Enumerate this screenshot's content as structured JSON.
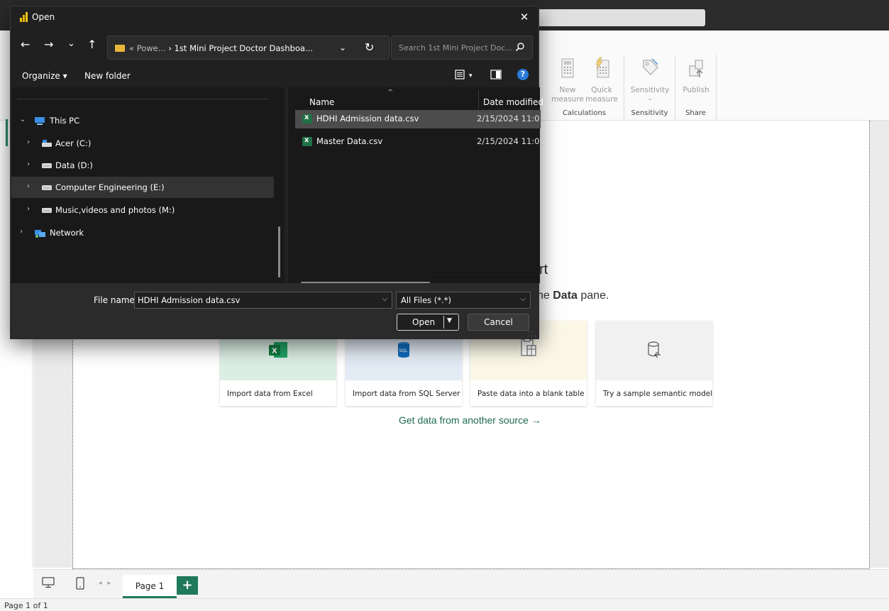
{
  "ribbon": {
    "buttons": [
      {
        "label_line1": "New",
        "label_line2": "measure",
        "icon": "calculator-icon"
      },
      {
        "label_line1": "Quick",
        "label_line2": "measure",
        "icon": "quick-measure-icon"
      },
      {
        "label_line1": "Sensitivity",
        "label_line2": "⌄",
        "icon": "sensitivity-icon"
      },
      {
        "label_line1": "Publish",
        "label_line2": "",
        "icon": "publish-icon"
      }
    ],
    "groups": [
      "Calculations",
      "Sensitivity",
      "Share"
    ]
  },
  "canvas": {
    "heading_fragment": "rt",
    "subtitle_fragment_prefix": "he ",
    "subtitle_bold": "Data",
    "subtitle_suffix": " pane.",
    "cards": [
      {
        "label": "Import data from Excel",
        "icon": "excel-icon",
        "bg": "#dcefe5"
      },
      {
        "label": "Import data from SQL Server",
        "icon": "sql-server-icon",
        "bg": "#e3ebf5"
      },
      {
        "label": "Paste data into a blank table",
        "icon": "paste-table-icon",
        "bg": "#fbf8e8"
      },
      {
        "label": "Try a sample semantic model",
        "icon": "sample-model-icon",
        "bg": "#f1f1f1"
      }
    ],
    "get_data_link": "Get data from another source →"
  },
  "bottombar": {
    "page_tab": "Page 1",
    "add_page": "+",
    "status": "Page 1 of 1"
  },
  "dialog": {
    "title": "Open",
    "close": "✕",
    "nav": {
      "back": "←",
      "forward": "→",
      "recent": "⌄",
      "up": "↑"
    },
    "address": {
      "prefix": "« Powe...",
      "separator": "›",
      "current": "1st Mini Project Doctor Dashboa...",
      "dropdown": "⌄",
      "refresh": "↻"
    },
    "search_placeholder": "Search 1st Mini Project Doc...",
    "toolbar": {
      "organize": "Organize ▾",
      "new_folder": "New folder",
      "view_caret": "▾",
      "help": "?"
    },
    "tree": [
      {
        "label": "This PC",
        "chev": "⌄",
        "icon": "pc-icon",
        "indent": 0,
        "selected": false
      },
      {
        "label": "Acer (C:)",
        "chev": "›",
        "icon": "drive-c-icon",
        "indent": 1,
        "selected": false
      },
      {
        "label": "Data (D:)",
        "chev": "›",
        "icon": "drive-icon",
        "indent": 1,
        "selected": false
      },
      {
        "label": "Computer Engineering (E:)",
        "chev": "›",
        "icon": "drive-icon",
        "indent": 1,
        "selected": true
      },
      {
        "label": "Music,videos and photos (M:)",
        "chev": "›",
        "icon": "drive-icon",
        "indent": 1,
        "selected": false
      },
      {
        "label": "Network",
        "chev": "›",
        "icon": "network-icon",
        "indent": 0,
        "selected": false
      }
    ],
    "columns": {
      "name": "Name",
      "date": "Date modified",
      "sort": "^"
    },
    "files": [
      {
        "name": "HDHI Admission data.csv",
        "date": "2/15/2024 11:0",
        "selected": true
      },
      {
        "name": "Master Data.csv",
        "date": "2/15/2024 11:0",
        "selected": false
      }
    ],
    "file_name_label": "File name:",
    "file_name_value": "HDHI Admission data.csv",
    "file_type": "All Files (*.*)",
    "open_button": "Open",
    "cancel_button": "Cancel"
  }
}
